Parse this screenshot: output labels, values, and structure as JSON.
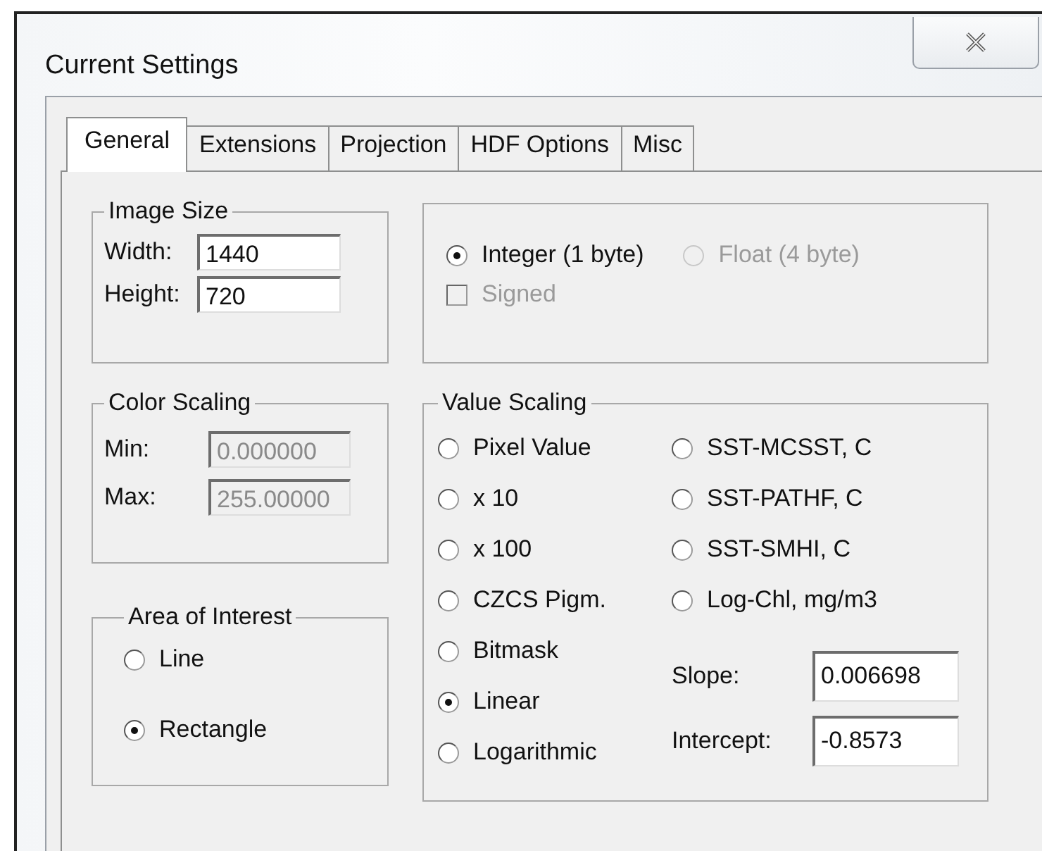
{
  "window": {
    "title": "Current Settings"
  },
  "tabs": [
    {
      "label": "General",
      "selected": true
    },
    {
      "label": "Extensions",
      "selected": false
    },
    {
      "label": "Projection",
      "selected": false
    },
    {
      "label": "HDF Options",
      "selected": false
    },
    {
      "label": "Misc",
      "selected": false
    }
  ],
  "image_size": {
    "title": "Image Size",
    "fields": [
      {
        "label": "Width:",
        "value": "1440",
        "disabled": false
      },
      {
        "label": "Height:",
        "value": "720",
        "disabled": false
      }
    ]
  },
  "data_type": {
    "options": [
      {
        "label": "Integer (1 byte)",
        "selected": true,
        "disabled": false
      },
      {
        "label": "Float (4 byte)",
        "selected": false,
        "disabled": true
      }
    ],
    "signed": {
      "label": "Signed",
      "checked": false,
      "disabled": true
    }
  },
  "color_scaling": {
    "title": "Color Scaling",
    "fields": [
      {
        "label": "Min:",
        "value": "0.000000",
        "disabled": true
      },
      {
        "label": "Max:",
        "value": "255.00000",
        "disabled": true
      }
    ]
  },
  "area_of_interest": {
    "title": "Area of Interest",
    "options": [
      {
        "label": "Line",
        "selected": false,
        "disabled": false
      },
      {
        "label": "Rectangle",
        "selected": true,
        "disabled": false
      }
    ]
  },
  "value_scaling": {
    "title": "Value Scaling",
    "column_1": [
      {
        "label": "Pixel Value",
        "selected": false,
        "disabled": false
      },
      {
        "label": "x 10",
        "selected": false,
        "disabled": false
      },
      {
        "label": "x 100",
        "selected": false,
        "disabled": false
      },
      {
        "label": "CZCS Pigm.",
        "selected": false,
        "disabled": false
      },
      {
        "label": "Bitmask",
        "selected": false,
        "disabled": false
      },
      {
        "label": "Linear",
        "selected": true,
        "disabled": false
      },
      {
        "label": "Logarithmic",
        "selected": false,
        "disabled": false
      }
    ],
    "column_2": [
      {
        "label": "SST-MCSST, C",
        "selected": false,
        "disabled": false
      },
      {
        "label": "SST-PATHF, C",
        "selected": false,
        "disabled": false
      },
      {
        "label": "SST-SMHI, C",
        "selected": false,
        "disabled": false
      },
      {
        "label": "Log-Chl, mg/m3",
        "selected": false,
        "disabled": false
      }
    ],
    "fields": [
      {
        "label": "Slope:",
        "value": "0.006698",
        "disabled": false
      },
      {
        "label": "Intercept:",
        "value": "-0.8573",
        "disabled": false
      }
    ]
  }
}
